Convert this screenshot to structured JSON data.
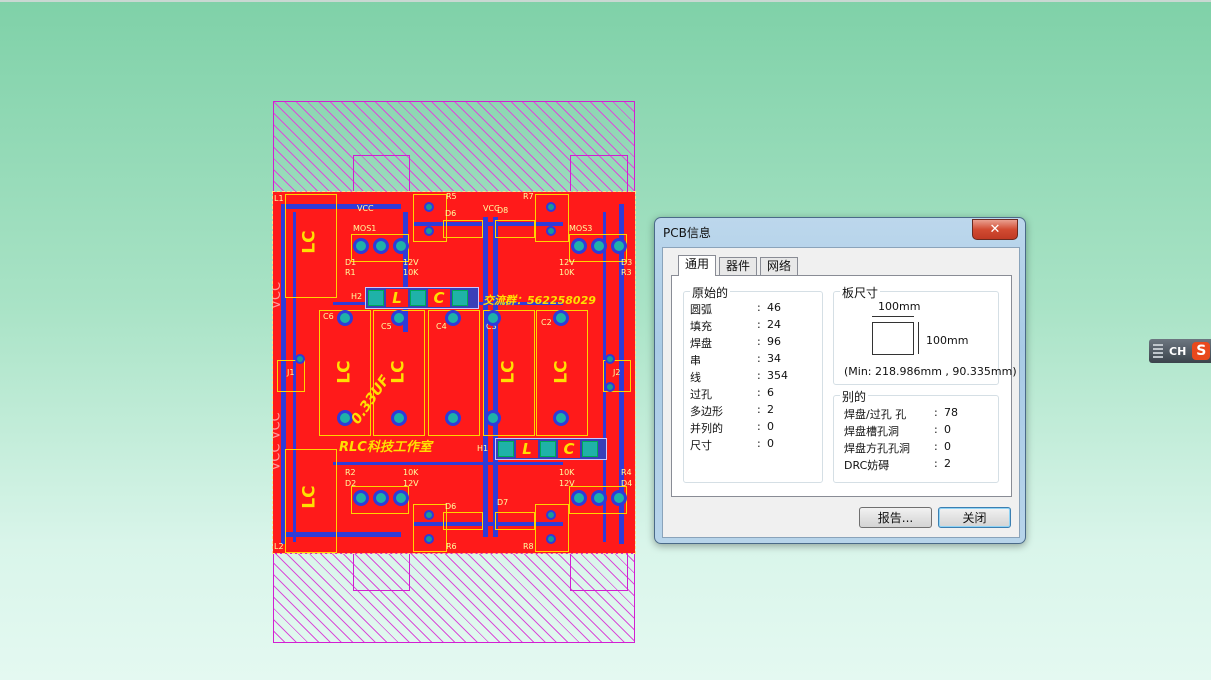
{
  "pcb": {
    "silk_lc": "LC",
    "silk_l": "L",
    "silk_c": "C",
    "qq_text": "交流群：562258029",
    "brand_text": "RLC科技工作室",
    "cap_value_text": "0.33UF",
    "vcc_text": "VCC VCC",
    "vcc_top": "VCC",
    "labels": {
      "mos1": "MOS1",
      "mos3": "MOS3",
      "c2": "C2",
      "c3": "C3",
      "c4": "C4",
      "c5": "C5",
      "c6": "C6",
      "j1": "J1",
      "j2": "J2",
      "d1": "D1",
      "d2": "D2",
      "d3": "D3",
      "d4": "D4",
      "d6": "D6",
      "d7": "D7",
      "d8": "D8",
      "r1": "R1",
      "r2": "R2",
      "r3": "R3",
      "r4": "R4",
      "r5": "R5",
      "r6": "R6",
      "r7": "R7",
      "r8": "R8",
      "h1": "H1",
      "h2": "H2",
      "l1": "L1",
      "l2": "L2",
      "v12": "12V",
      "r10k": "10K"
    }
  },
  "dialog": {
    "title": "PCB信息",
    "close_glyph": "✕",
    "tabs": [
      "通用",
      "器件",
      "网络"
    ],
    "original_group": {
      "title": "原始的",
      "rows": [
        {
          "k": "圆弧",
          "v": "46"
        },
        {
          "k": "填充",
          "v": "24"
        },
        {
          "k": "焊盘",
          "v": "96"
        },
        {
          "k": "串",
          "v": "34"
        },
        {
          "k": "线",
          "v": "354"
        },
        {
          "k": "过孔",
          "v": "6"
        },
        {
          "k": "多边形",
          "v": "2"
        },
        {
          "k": "并列的",
          "v": "0"
        },
        {
          "k": "尺寸",
          "v": "0"
        }
      ]
    },
    "board_size": {
      "title": "板尺寸",
      "width": "100mm",
      "height": "100mm",
      "min": "(Min: 218.986mm , 90.335mm)"
    },
    "other_group": {
      "title": "别的",
      "rows": [
        {
          "k": "焊盘/过孔 孔",
          "v": "78"
        },
        {
          "k": "焊盘槽孔洞",
          "v": "0"
        },
        {
          "k": "焊盘方孔孔洞",
          "v": "0"
        },
        {
          "k": "DRC妨碍",
          "v": "2"
        }
      ]
    },
    "colon": ":",
    "report_button": "报告...",
    "close_button": "关闭"
  },
  "ime": {
    "lang": "CH",
    "logo": "S"
  },
  "colors": {
    "board": "#ff1a1a",
    "trace": "#2f3bd9",
    "hatch": "#d21fd2",
    "silk": "#ffe000"
  }
}
